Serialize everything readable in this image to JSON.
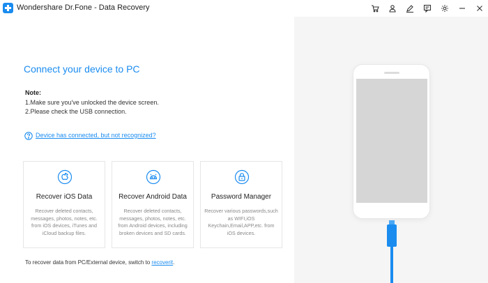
{
  "app": {
    "title": "Wondershare Dr.Fone - Data Recovery"
  },
  "toolbar": {
    "icons": [
      "cart-icon",
      "user-icon",
      "edit-icon",
      "feedback-icon",
      "settings-icon",
      "minimize-icon",
      "close-icon"
    ]
  },
  "main": {
    "heading": "Connect your device to PC",
    "note_title": "Note:",
    "note_lines": [
      "1.Make sure you've unlocked the device screen.",
      "2.Please check the USB connection."
    ],
    "help_link": "Device has connected, but not recognized?"
  },
  "cards": [
    {
      "title": "Recover iOS Data",
      "desc": "Recover deleted contacts, messages, photos, notes, etc. from iOS devices, iTunes and iCloud backup files.",
      "icon": "apple-icon"
    },
    {
      "title": "Recover Android Data",
      "desc": "Recover deleted contacts, messages, photos, notes, etc. from Android devices, including broken devices and SD cards.",
      "icon": "android-icon"
    },
    {
      "title": "Password Manager",
      "desc": "Recover various passwords,such as WIFI,iOS Keychain,Email,APP,etc. from iOS devices.",
      "icon": "lock-icon"
    }
  ],
  "footer": {
    "text": "To recover data from PC/External device, switch to ",
    "link": "recoverit",
    "end": "."
  },
  "colors": {
    "accent": "#1a8cf0",
    "panel": "#f5f5f5",
    "screen": "#d6d6d6"
  }
}
